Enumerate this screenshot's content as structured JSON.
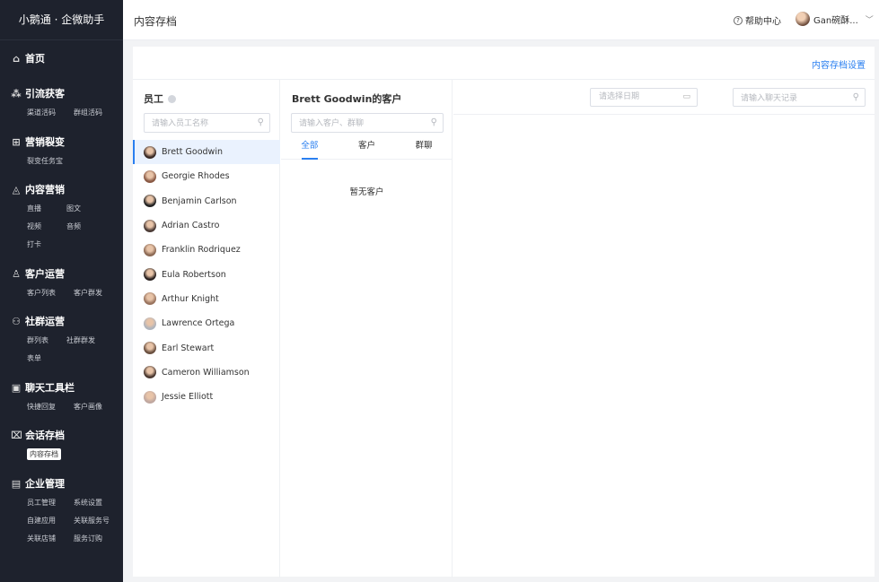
{
  "app": {
    "brand": "小鹅通 · 企微助手"
  },
  "sidebar": {
    "sections": [
      {
        "icon": "home-icon",
        "glyph": "⌂",
        "title": "首页",
        "rows": []
      },
      {
        "icon": "sitemap-icon",
        "glyph": "⁂",
        "title": "引流获客",
        "rows": [
          [
            "渠道活码",
            "群组活码"
          ]
        ]
      },
      {
        "icon": "fission-icon",
        "glyph": "⊞",
        "title": "营销裂变",
        "rows": [
          [
            "裂变任务宝"
          ]
        ]
      },
      {
        "icon": "content-icon",
        "glyph": "◬",
        "title": "内容营销",
        "rows": [
          [
            "直播",
            "图文"
          ],
          [
            "视频",
            "音频"
          ],
          [
            "打卡"
          ]
        ]
      },
      {
        "icon": "customer-icon",
        "glyph": "♙",
        "title": "客户运营",
        "rows": [
          [
            "客户列表",
            "客户群发"
          ]
        ]
      },
      {
        "icon": "community-icon",
        "glyph": "⚇",
        "title": "社群运营",
        "rows": [
          [
            "群列表",
            "社群群发"
          ],
          [
            "表单"
          ]
        ]
      },
      {
        "icon": "toolbar-icon",
        "glyph": "▣",
        "title": "聊天工具栏",
        "rows": [
          [
            "快捷回复",
            "客户画像"
          ]
        ]
      },
      {
        "icon": "archive-icon",
        "glyph": "⌧",
        "title": "会话存档",
        "rows": [
          [
            "内容存档"
          ]
        ]
      },
      {
        "icon": "enterprise-icon",
        "glyph": "▤",
        "title": "企业管理",
        "rows": [
          [
            "员工管理",
            "系统设置"
          ],
          [
            "自建应用",
            "关联服务号"
          ],
          [
            "关联店铺",
            "服务订购"
          ]
        ]
      }
    ],
    "active_item": "内容存档"
  },
  "topbar": {
    "title": "内容存档",
    "help": "帮助中心",
    "user": "Gan碗酥..."
  },
  "actionbar": {
    "settings_link": "内容存档设置"
  },
  "employees": {
    "title": "员工",
    "search_placeholder": "请输入员工名称",
    "selected": "Brett Goodwin",
    "list": [
      {
        "name": "Brett Goodwin",
        "color": "#3a2a25"
      },
      {
        "name": "Georgie Rhodes",
        "color": "#8a5a45"
      },
      {
        "name": "Benjamin Carlson",
        "color": "#222222"
      },
      {
        "name": "Adrian Castro",
        "color": "#4a3a35"
      },
      {
        "name": "Franklin Rodriquez",
        "color": "#8c6a55"
      },
      {
        "name": "Eula Robertson",
        "color": "#2a2220"
      },
      {
        "name": "Arthur Knight",
        "color": "#9a7560"
      },
      {
        "name": "Lawrence Ortega",
        "color": "#b0b4bc"
      },
      {
        "name": "Earl Stewart",
        "color": "#6a5040"
      },
      {
        "name": "Cameron Williamson",
        "color": "#4a3830"
      },
      {
        "name": "Jessie Elliott",
        "color": "#c0a8a0"
      }
    ]
  },
  "customers": {
    "title": "Brett Goodwin的客户",
    "search_placeholder": "请输入客户、群聊",
    "tabs": [
      "全部",
      "客户",
      "群聊"
    ],
    "active_tab": "全部",
    "empty_text": "暂无客户"
  },
  "chat": {
    "date_placeholder": "请选择日期",
    "search_placeholder": "请输入聊天记录"
  },
  "colors": {
    "accent": "#2a7ff0",
    "sidebar_bg": "#1e222d"
  }
}
